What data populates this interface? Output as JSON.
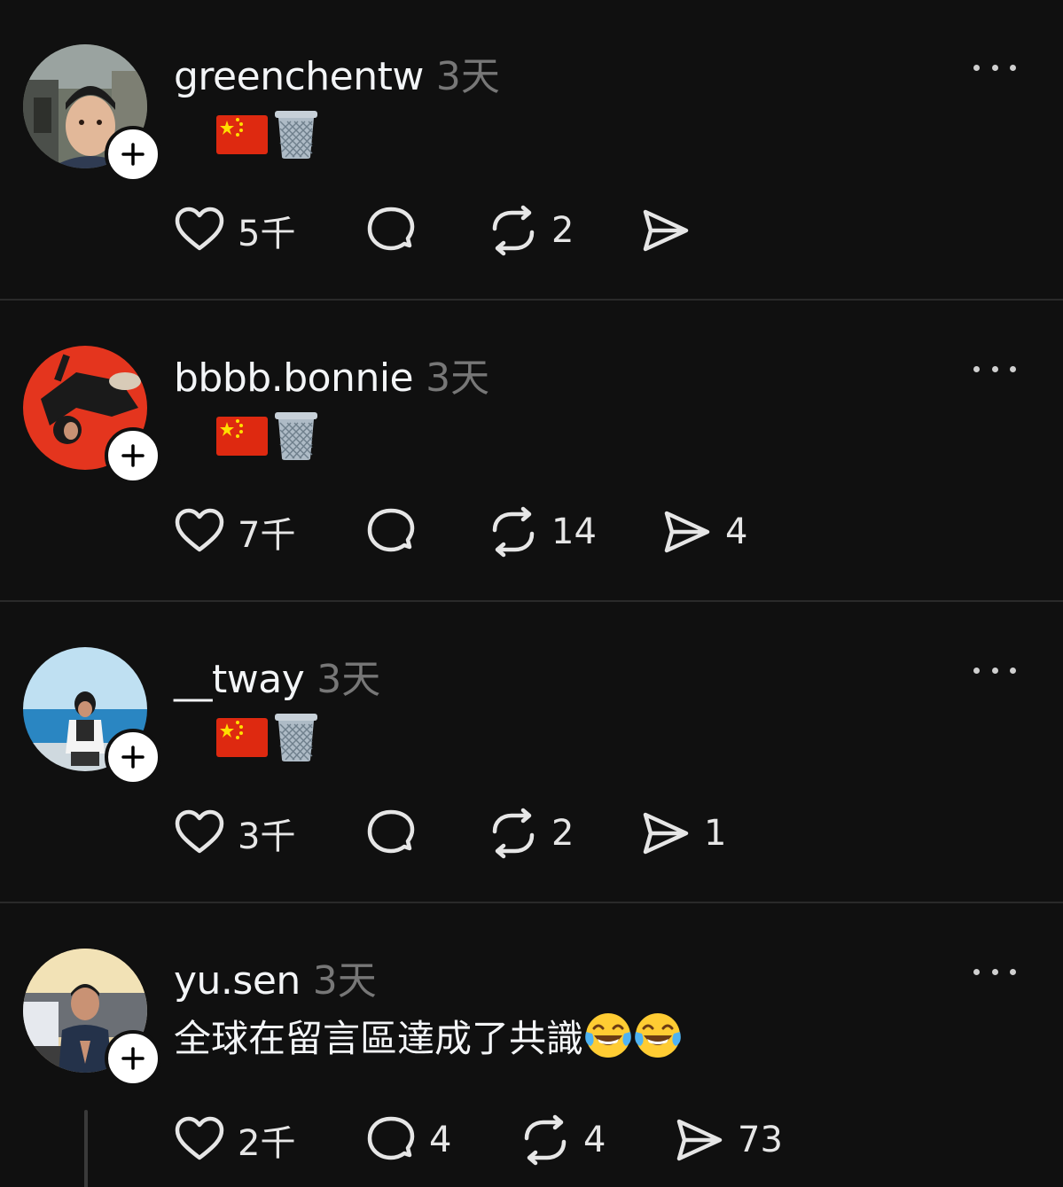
{
  "posts": [
    {
      "username": "greenchentw",
      "time": "3天",
      "content_type": "emoji",
      "content_emoji": [
        "cn-flag",
        "wastebasket"
      ],
      "likes": "5千",
      "replies": "",
      "reposts": "2",
      "shares": ""
    },
    {
      "username": "bbbb.bonnie",
      "time": "3天",
      "content_type": "emoji",
      "content_emoji": [
        "cn-flag",
        "wastebasket"
      ],
      "likes": "7千",
      "replies": "",
      "reposts": "14",
      "shares": "4"
    },
    {
      "username": "__tway",
      "time": "3天",
      "content_type": "emoji",
      "content_emoji": [
        "cn-flag",
        "wastebasket"
      ],
      "likes": "3千",
      "replies": "",
      "reposts": "2",
      "shares": "1"
    },
    {
      "username": "yu.sen",
      "time": "3天",
      "content_type": "text",
      "text": "全球在留言區達成了共識",
      "content_emoji": [
        "tears-of-joy",
        "tears-of-joy"
      ],
      "likes": "2千",
      "replies": "4",
      "reposts": "4",
      "shares": "73"
    }
  ],
  "icons": {
    "like": "heart-icon",
    "reply": "comment-bubble-icon",
    "repost": "repost-icon",
    "share": "send-icon",
    "more": "more-options-icon",
    "follow": "plus-icon"
  },
  "colors": {
    "background": "#101010",
    "divider": "#2a2a2a",
    "text": "#f3f5f7",
    "muted": "#777777"
  }
}
